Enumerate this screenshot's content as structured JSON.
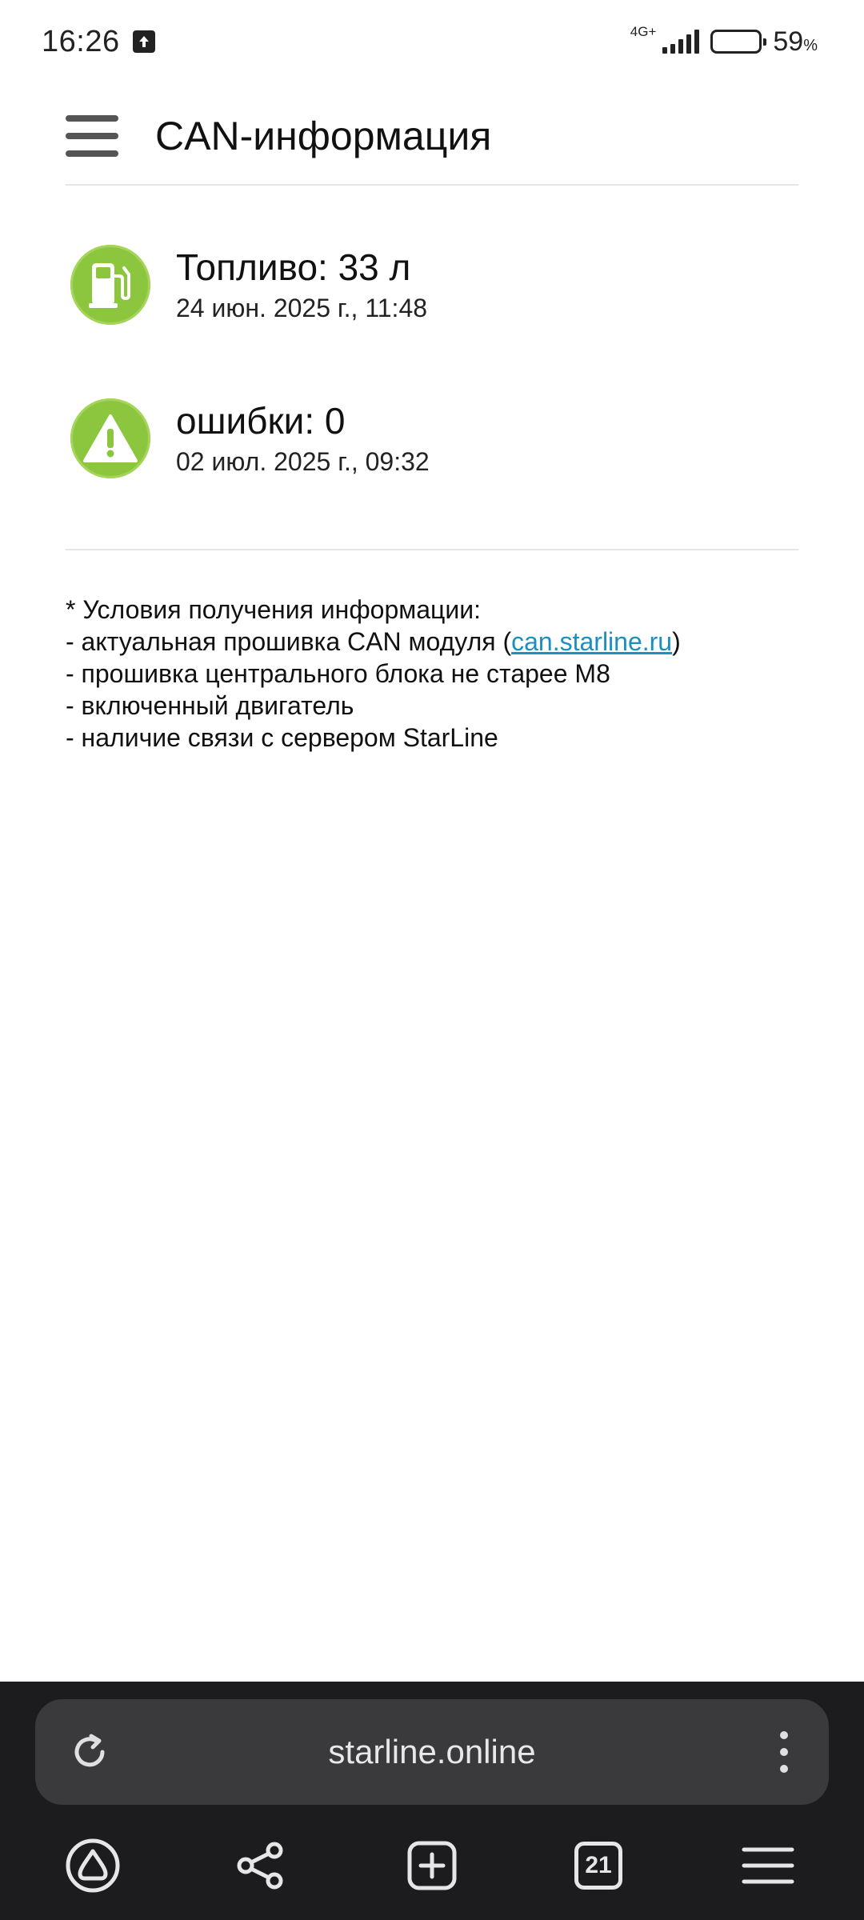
{
  "status_bar": {
    "time": "16:26",
    "network": "4G+",
    "battery_percent": "59",
    "battery_unit": "%",
    "battery_level": 0.59
  },
  "header": {
    "title": "CAN-информация",
    "menu_icon": "hamburger-menu-icon"
  },
  "info_items": [
    {
      "icon": "fuel-pump-icon",
      "value": "Топливо: 33 л",
      "date": "24 июн. 2025 г., 11:48"
    },
    {
      "icon": "warning-triangle-icon",
      "value": "ошибки: 0",
      "date": "02 июл. 2025 г., 09:32"
    }
  ],
  "notes": {
    "heading": "* Условия получения информации:",
    "line1_prefix": "- актуальная прошивка CAN модуля (",
    "line1_link": "can.starline.ru",
    "line1_suffix": ")",
    "line2": "- прошивка центрального блока не старее М8",
    "line3": "- включенный двигатель",
    "line4": "- наличие связи с сервером StarLine"
  },
  "browser": {
    "url": "starline.online",
    "tabs_count": "21",
    "icons": [
      "reload-icon",
      "more-options-icon",
      "alice-icon",
      "share-icon",
      "new-tab-icon",
      "tabs-icon",
      "menu-icon"
    ]
  },
  "colors": {
    "icon_green": "#8cc63f",
    "link": "#1a8fc0",
    "browser_bar": "#1c1c1e",
    "address_bar": "#3a3a3c"
  }
}
